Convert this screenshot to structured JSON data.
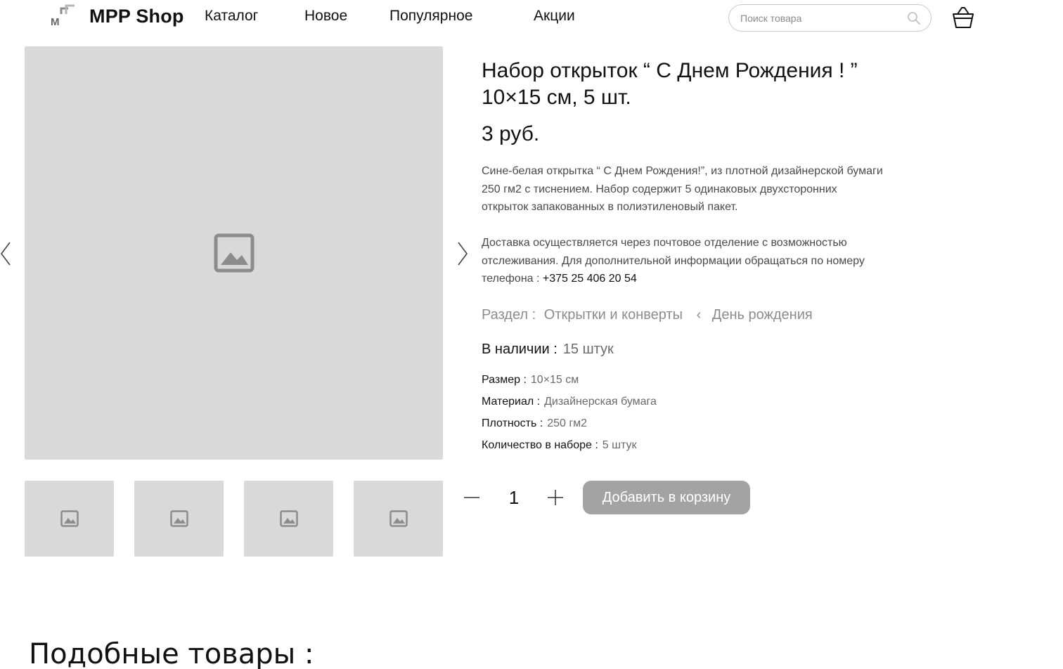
{
  "header": {
    "brand": "MPP Shop",
    "logo_icon": "mpp-logo-icon",
    "nav": [
      "Каталог",
      "Новое",
      "Популярное",
      "Акции"
    ],
    "search_placeholder": "Поиск товара",
    "search_icon": "search-icon",
    "cart_icon": "basket-icon"
  },
  "gallery": {
    "image_placeholder_icon": "image-icon",
    "thumbnail_count": 4,
    "prev_icon": "chevron-left-icon",
    "next_icon": "chevron-right-icon",
    "placeholder_color": "#d9d9d9"
  },
  "product": {
    "title_line1": "Набор открыток “ С Днем Рождения ! ”",
    "title_line2": "10×15 см, 5 шт.",
    "price": "3 руб.",
    "description": [
      "Сине-белая открытка “ С Днем Рождения!”, из плотной дизайнерской бумаги",
      "250 гм2 с тиснением. Набор содержит 5 одинаковых двухсторонних",
      "открыток запакованных в полиэтиленовый пакет."
    ],
    "delivery": [
      "Доставка осуществляется через почтовое отделение с возможностью",
      "отслеживания. Для дополнительной информации обращаться по номеру",
      "телефона :"
    ],
    "phone": "+375 25 406 20 54",
    "section_label": "Раздел :",
    "section_category": "Открытки и конверты",
    "section_separator": "‹",
    "section_subcategory": "День рождения",
    "stock_label": "В наличии :",
    "stock_value": "15 штук",
    "specs": [
      {
        "label": "Размер :",
        "value": "10×15 см"
      },
      {
        "label": "Материал :",
        "value": "Дизайнерская бумага"
      },
      {
        "label": "Плотность :",
        "value": "250 гм2"
      },
      {
        "label": "Количество в наборе :",
        "value": "5 штук"
      }
    ]
  },
  "purchase": {
    "quantity": "1",
    "decrement_icon": "minus-icon",
    "increment_icon": "plus-icon",
    "add_to_cart_label": "Добавить в корзину",
    "button_color": "#a3a3a3"
  },
  "similar": {
    "heading": "Подобные товары :"
  }
}
